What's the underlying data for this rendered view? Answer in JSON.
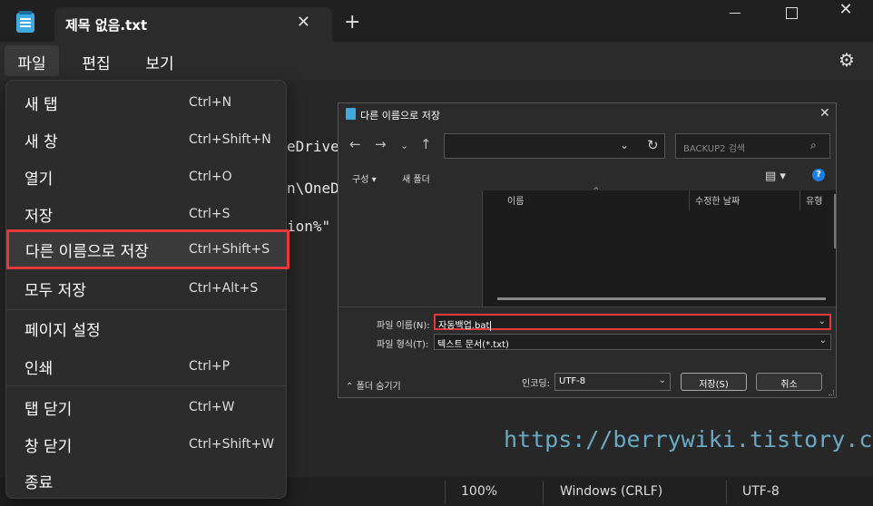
{
  "window": {
    "tab_title": "제목 없음.txt",
    "tab_close": "✕",
    "new_tab": "+",
    "close_glyph": "✕"
  },
  "menubar": {
    "file": "파일",
    "edit": "편집",
    "view": "보기"
  },
  "editor": {
    "lines": [
      "eDrive",
      "n\\OneD",
      "",
      "ion%\""
    ]
  },
  "file_menu": {
    "items": [
      {
        "label": "새 탭",
        "shortcut": "Ctrl+N"
      },
      {
        "label": "새 창",
        "shortcut": "Ctrl+Shift+N"
      },
      {
        "label": "열기",
        "shortcut": "Ctrl+O"
      },
      {
        "label": "저장",
        "shortcut": "Ctrl+S"
      },
      {
        "label": "다른 이름으로 저장",
        "shortcut": "Ctrl+Shift+S"
      },
      {
        "label": "모두 저장",
        "shortcut": "Ctrl+Alt+S"
      },
      {
        "label": "페이지 설정",
        "shortcut": ""
      },
      {
        "label": "인쇄",
        "shortcut": "Ctrl+P"
      },
      {
        "label": "탭 닫기",
        "shortcut": "Ctrl+W"
      },
      {
        "label": "창 닫기",
        "shortcut": "Ctrl+Shift+W"
      },
      {
        "label": "종료",
        "shortcut": ""
      }
    ]
  },
  "dialog": {
    "title": "다른 이름으로 저장",
    "search_placeholder": "BACKUP2 검색",
    "organize": "구성 ▾",
    "new_folder": "새 폴더",
    "columns": {
      "name": "이름",
      "modified": "수정한 날짜",
      "type": "유형"
    },
    "filename_label": "파일 이름(N):",
    "filename_value": "자동백업.bat",
    "filetype_label": "파일 형식(T):",
    "filetype_value": "텍스트 문서(*.txt)",
    "hide_folders": "폴더 숨기기",
    "encoding_label": "인코딩:",
    "encoding_value": "UTF-8",
    "save": "저장(S)",
    "cancel": "취소"
  },
  "statusbar": {
    "zoom": "100%",
    "line_ending": "Windows (CRLF)",
    "encoding": "UTF-8"
  },
  "watermark": "https://berrywiki.tistory.com",
  "colors": {
    "highlight_border": "#e5383b",
    "accent": "#1a7fe0"
  }
}
